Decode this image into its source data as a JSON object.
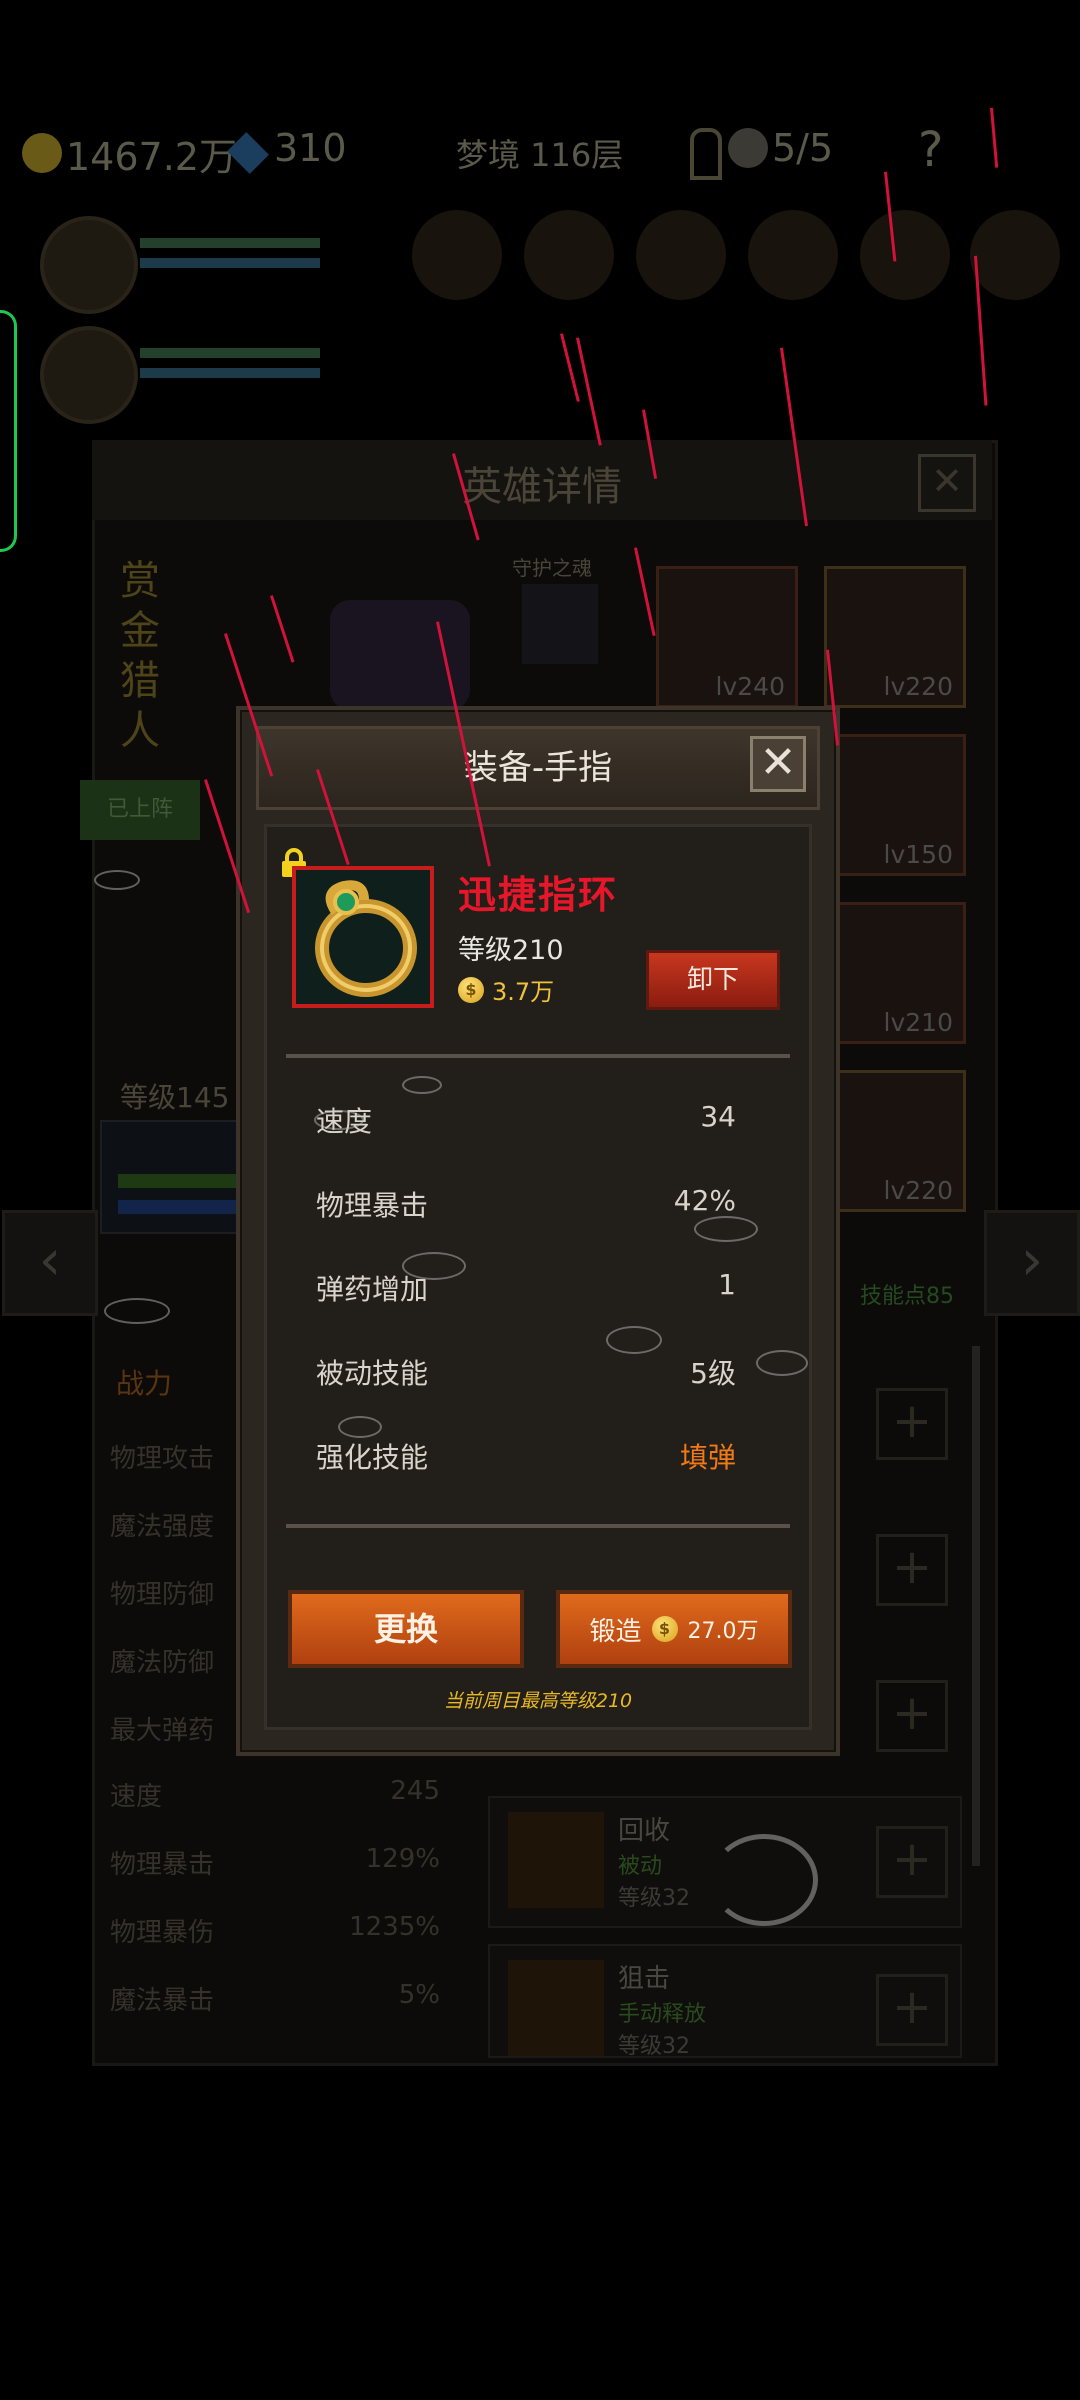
{
  "background": {
    "currencies": {
      "gold": "1467.2万",
      "gems": "310",
      "stage": "梦境 116层",
      "keys": "5/5",
      "help": "?"
    },
    "hero_panel": {
      "title": "英雄详情",
      "hero_name": "赏\n金\n猎\n人",
      "deployed_tag": "已上阵",
      "guardian_label": "守护之魂",
      "level_label": "等级145",
      "skill_points": "技能点85",
      "equipment_levels": [
        "lv240",
        "lv220",
        "lv150",
        "lv210",
        "lv220"
      ],
      "stats_header": "战力",
      "stats": [
        {
          "label": "物理攻击",
          "value": ""
        },
        {
          "label": "魔法强度",
          "value": ""
        },
        {
          "label": "物理防御",
          "value": ""
        },
        {
          "label": "魔法防御",
          "value": ""
        },
        {
          "label": "最大弹药",
          "value": ""
        },
        {
          "label": "速度",
          "value": "245"
        },
        {
          "label": "物理暴击",
          "value": "129%"
        },
        {
          "label": "物理暴伤",
          "value": "1235%"
        },
        {
          "label": "魔法暴击",
          "value": "5%"
        }
      ],
      "skills": [
        {
          "name": "回收",
          "type": "被动",
          "level": "等级32"
        },
        {
          "name": "狙击",
          "type": "手动释放",
          "level": "等级32"
        }
      ],
      "nav_left": "‹",
      "nav_right": "›"
    }
  },
  "modal": {
    "title": "装备-手指",
    "close": "✕",
    "item": {
      "name": "迅捷指环",
      "level": "等级210",
      "price": "3.7万",
      "coin_symbol": "$"
    },
    "unequip_button": "卸下",
    "stats": [
      {
        "label": "速度",
        "value": "34"
      },
      {
        "label": "物理暴击",
        "value": "42%"
      },
      {
        "label": "弹药增加",
        "value": "1"
      },
      {
        "label": "被动技能",
        "value": "5级"
      },
      {
        "label": "强化技能",
        "value": "填弹",
        "highlight": true
      }
    ],
    "replace_button": "更换",
    "forge_button": {
      "label": "锻造",
      "cost": "27.0万"
    },
    "cap_note": "当前周目最高等级210"
  },
  "colors": {
    "rarity_red": "#e6172a",
    "button_orange": "#d0561a",
    "highlight_orange": "#f07a18",
    "gold": "#f0c13a"
  }
}
